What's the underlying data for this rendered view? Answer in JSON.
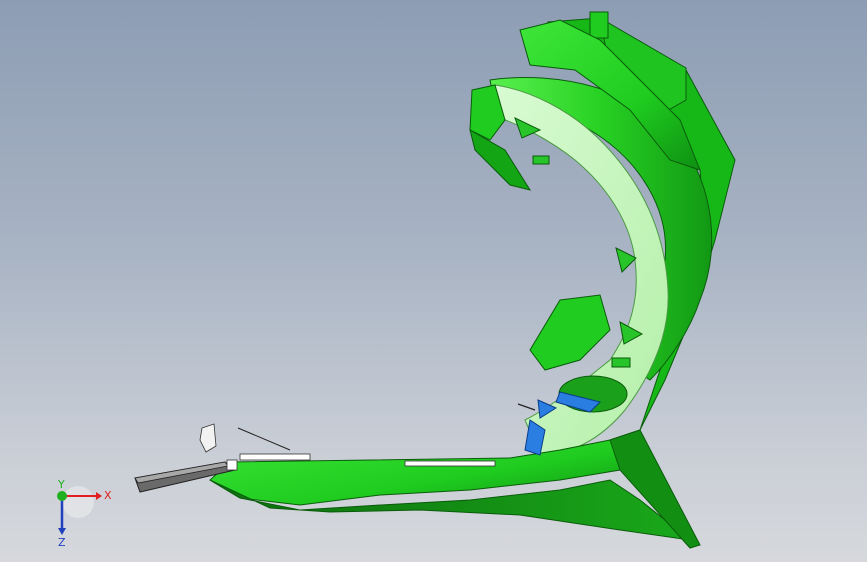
{
  "viewport": {
    "background_top": "#8d9db4",
    "background_bottom": "#d6d8dc"
  },
  "model": {
    "primary_color": "#1fcc1f",
    "highlight_color": "#c8f5c0",
    "shadow_color": "#0e7d10",
    "accent_blue": "#2a7de1"
  },
  "triad": {
    "x_label": "X",
    "y_label": "Y",
    "z_label": "Z",
    "x_color": "#e02020",
    "y_color": "#20b020",
    "z_color": "#2040c0"
  }
}
